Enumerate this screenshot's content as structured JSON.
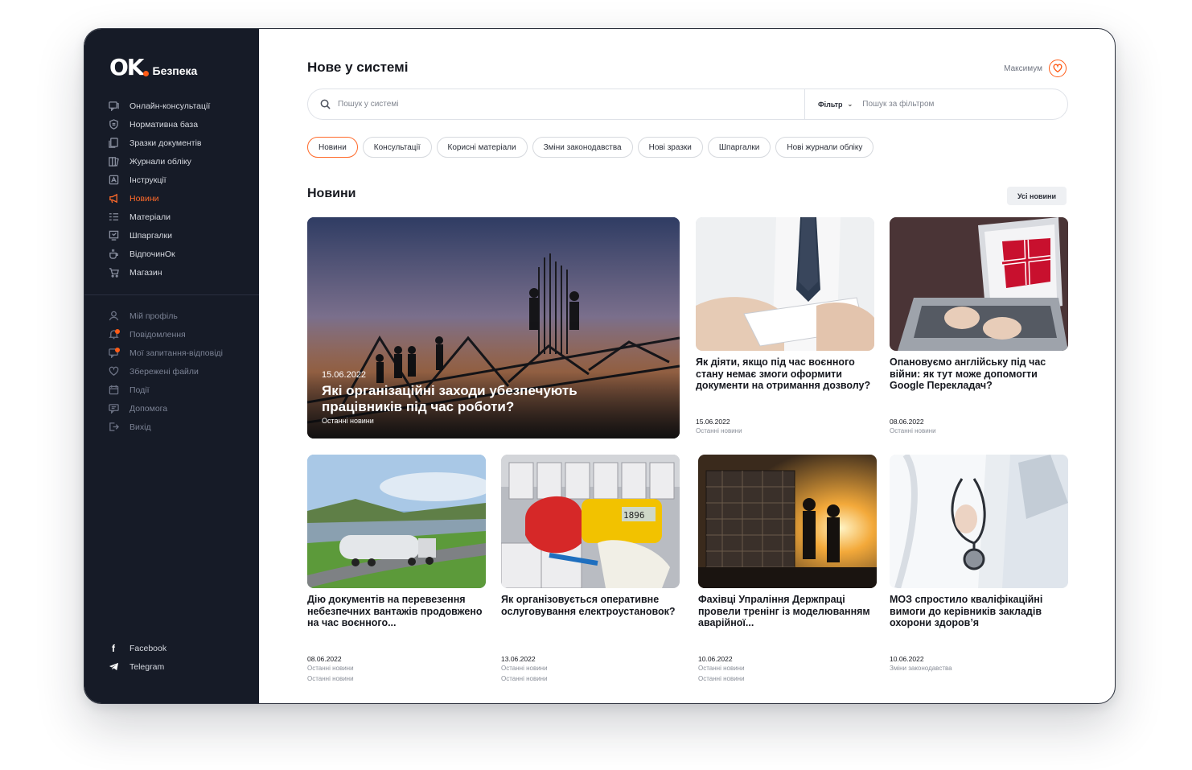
{
  "brand": {
    "logo_mark": "OK",
    "name": "Безпека",
    "accent": "#ff5b16"
  },
  "sidebar": {
    "items": [
      {
        "label": "Онлайн-консультації",
        "icon": "chat-icon"
      },
      {
        "label": "Нормативна база",
        "icon": "shield-icon"
      },
      {
        "label": "Зразки документів",
        "icon": "documents-icon"
      },
      {
        "label": "Журнали обліку",
        "icon": "book-icon"
      },
      {
        "label": "Інструкції",
        "icon": "instruction-icon"
      },
      {
        "label": "Новини",
        "icon": "megaphone-icon",
        "active": true
      },
      {
        "label": "Матеріали",
        "icon": "list-icon"
      },
      {
        "label": "Шпаргалки",
        "icon": "cheatsheet-icon"
      },
      {
        "label": "ВідпочинОк",
        "icon": "coffee-icon"
      },
      {
        "label": "Магазин",
        "icon": "cart-icon"
      }
    ],
    "secondary": [
      {
        "label": "Мій профіль",
        "icon": "user-icon"
      },
      {
        "label": "Повідомлення",
        "icon": "bell-icon"
      },
      {
        "label": "Мої запитання-відповіді",
        "icon": "question-icon"
      },
      {
        "label": "Збережені файли",
        "icon": "heart-icon"
      },
      {
        "label": "Події",
        "icon": "calendar-icon"
      },
      {
        "label": "Допомога",
        "icon": "help-icon"
      },
      {
        "label": "Вихід",
        "icon": "logout-icon"
      }
    ],
    "social": [
      {
        "label": "Facebook",
        "icon": "facebook-icon"
      },
      {
        "label": "Telegram",
        "icon": "telegram-icon"
      }
    ]
  },
  "header": {
    "title": "Нове у системі",
    "user_name": "Максимум"
  },
  "search": {
    "placeholder": "Пошук у системі",
    "filter_label": "Фільтр",
    "filter_placeholder": "Пошук за фільтром"
  },
  "chips": [
    {
      "label": "Новини",
      "active": true
    },
    {
      "label": "Консультації"
    },
    {
      "label": "Корисні матеріали"
    },
    {
      "label": "Зміни законодавства"
    },
    {
      "label": "Нові зразки"
    },
    {
      "label": "Шпаргалки"
    },
    {
      "label": "Нові журнали обліку"
    }
  ],
  "news": {
    "section_title": "Новини",
    "all_button": "Усі новини",
    "hero": {
      "date": "15.06.2022",
      "title": "Які організаційні заходи убезпечують працівників під час роботи?",
      "category": "Останні новини"
    },
    "cards": [
      {
        "title": "Як діяти, якщо під час воєнного стану немає змоги оформити документи на отримання дозволу?",
        "date": "15.06.2022",
        "category": "Останні новини",
        "category2": ""
      },
      {
        "title": "Опановуємо англійську під час війни: як тут може допомогти Google Перекладач?",
        "date": "08.06.2022",
        "category": "Останні новини",
        "category2": ""
      },
      {
        "title": "Дію документів на перевезення небезпечних вантажів продовжено на час воєнного...",
        "date": "08.06.2022",
        "category": "Останні новини",
        "category2": "Останні новини"
      },
      {
        "title": "Як організовується оперативне ослуговування електроустановок?",
        "date": "13.06.2022",
        "category": "Останні новини",
        "category2": "Останні новини"
      },
      {
        "title": "Фахівці Упраління Держпраці провели тренінг із моделюванням аварійної...",
        "date": "10.06.2022",
        "category": "Останні новини",
        "category2": "Останні новини"
      },
      {
        "title": "МОЗ спростило кваліфікаційні вимоги до керівників закладів охорони здоров’я",
        "date": "10.06.2022",
        "category": "Зміни законодавства",
        "category2": ""
      }
    ]
  }
}
